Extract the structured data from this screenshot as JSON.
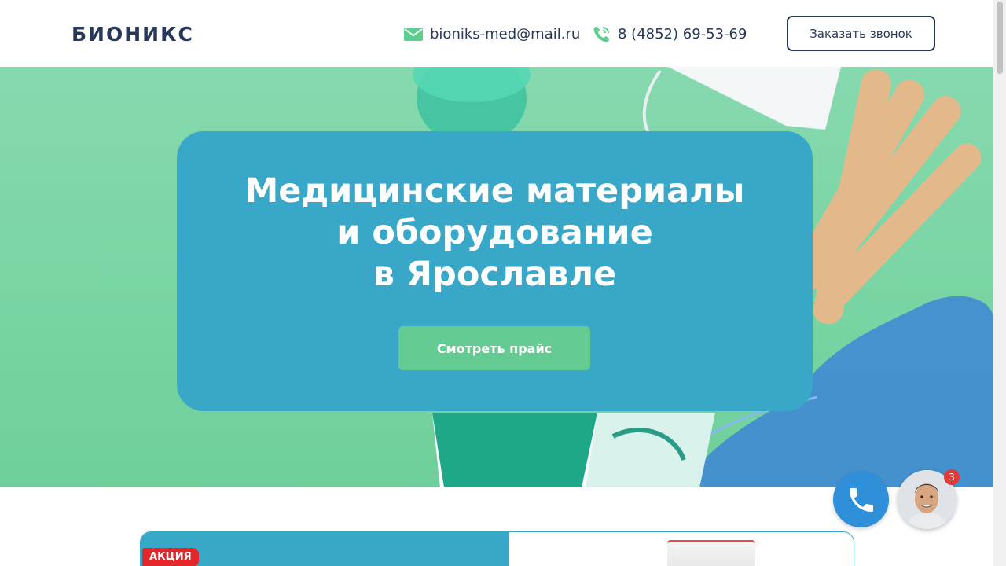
{
  "header": {
    "logo": "БИОНИКС",
    "email": "bioniks-med@mail.ru",
    "phone": "8 (4852) 69-53-69",
    "callback_label": "Заказать звонок",
    "email_icon": "mail-icon",
    "phone_icon": "phone-icon"
  },
  "hero": {
    "title_lines": [
      "Медицинские материалы",
      "и оборудование",
      "в Ярославле"
    ],
    "button_label": "Смотреть прайс"
  },
  "promo": {
    "badge": "АКЦИЯ"
  },
  "widgets": {
    "call_icon": "phone-icon",
    "chat_badge_count": "3"
  },
  "colors": {
    "brand_dark": "#27385a",
    "accent_green": "#64cc93",
    "card_blue": "#39a8c8",
    "hero_bg": "#7fd6a8",
    "badge_red": "#e3262b"
  }
}
